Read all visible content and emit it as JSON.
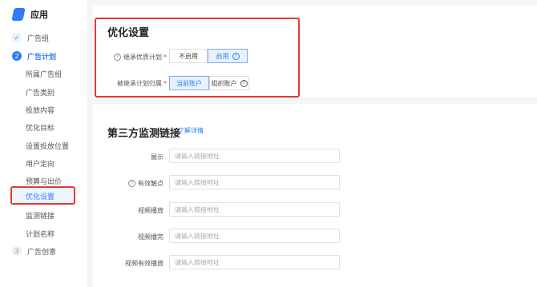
{
  "app": {
    "title": "应用"
  },
  "nav": {
    "steps": [
      {
        "num": "✓",
        "label": "广告组"
      },
      {
        "num": "2",
        "label": "广告计划"
      },
      {
        "num": "3",
        "label": "广告创意"
      }
    ],
    "sub_items": [
      "所属广告组",
      "广告类别",
      "投放内容",
      "优化目标",
      "设置投放位置",
      "用户定向",
      "预算与出价",
      "优化设置",
      "监测链接",
      "计划名称"
    ]
  },
  "optimize": {
    "title": "优化设置",
    "inherit_label": "继承优质计划",
    "inherit_options": [
      "不启用",
      "启用"
    ],
    "inherit_selected": "启用",
    "attribution_label": "被继承计划归属",
    "attribution_options": [
      "当前账户",
      "组织账户"
    ],
    "attribution_selected": "当前账户"
  },
  "monitor": {
    "title": "第三方监测链接",
    "learn_more": "了解详情",
    "fields": [
      {
        "label": "展示",
        "placeholder": "请输入链接地址"
      },
      {
        "label": "有效触点",
        "placeholder": "请输入链接地址"
      },
      {
        "label": "视频播放",
        "placeholder": "请输入链接地址"
      },
      {
        "label": "视频播完",
        "placeholder": "请输入链接地址"
      },
      {
        "label": "视频有效播放",
        "placeholder": "请输入链接地址"
      }
    ]
  },
  "colors": {
    "accent": "#2f7cf6",
    "highlight": "#e53935"
  }
}
